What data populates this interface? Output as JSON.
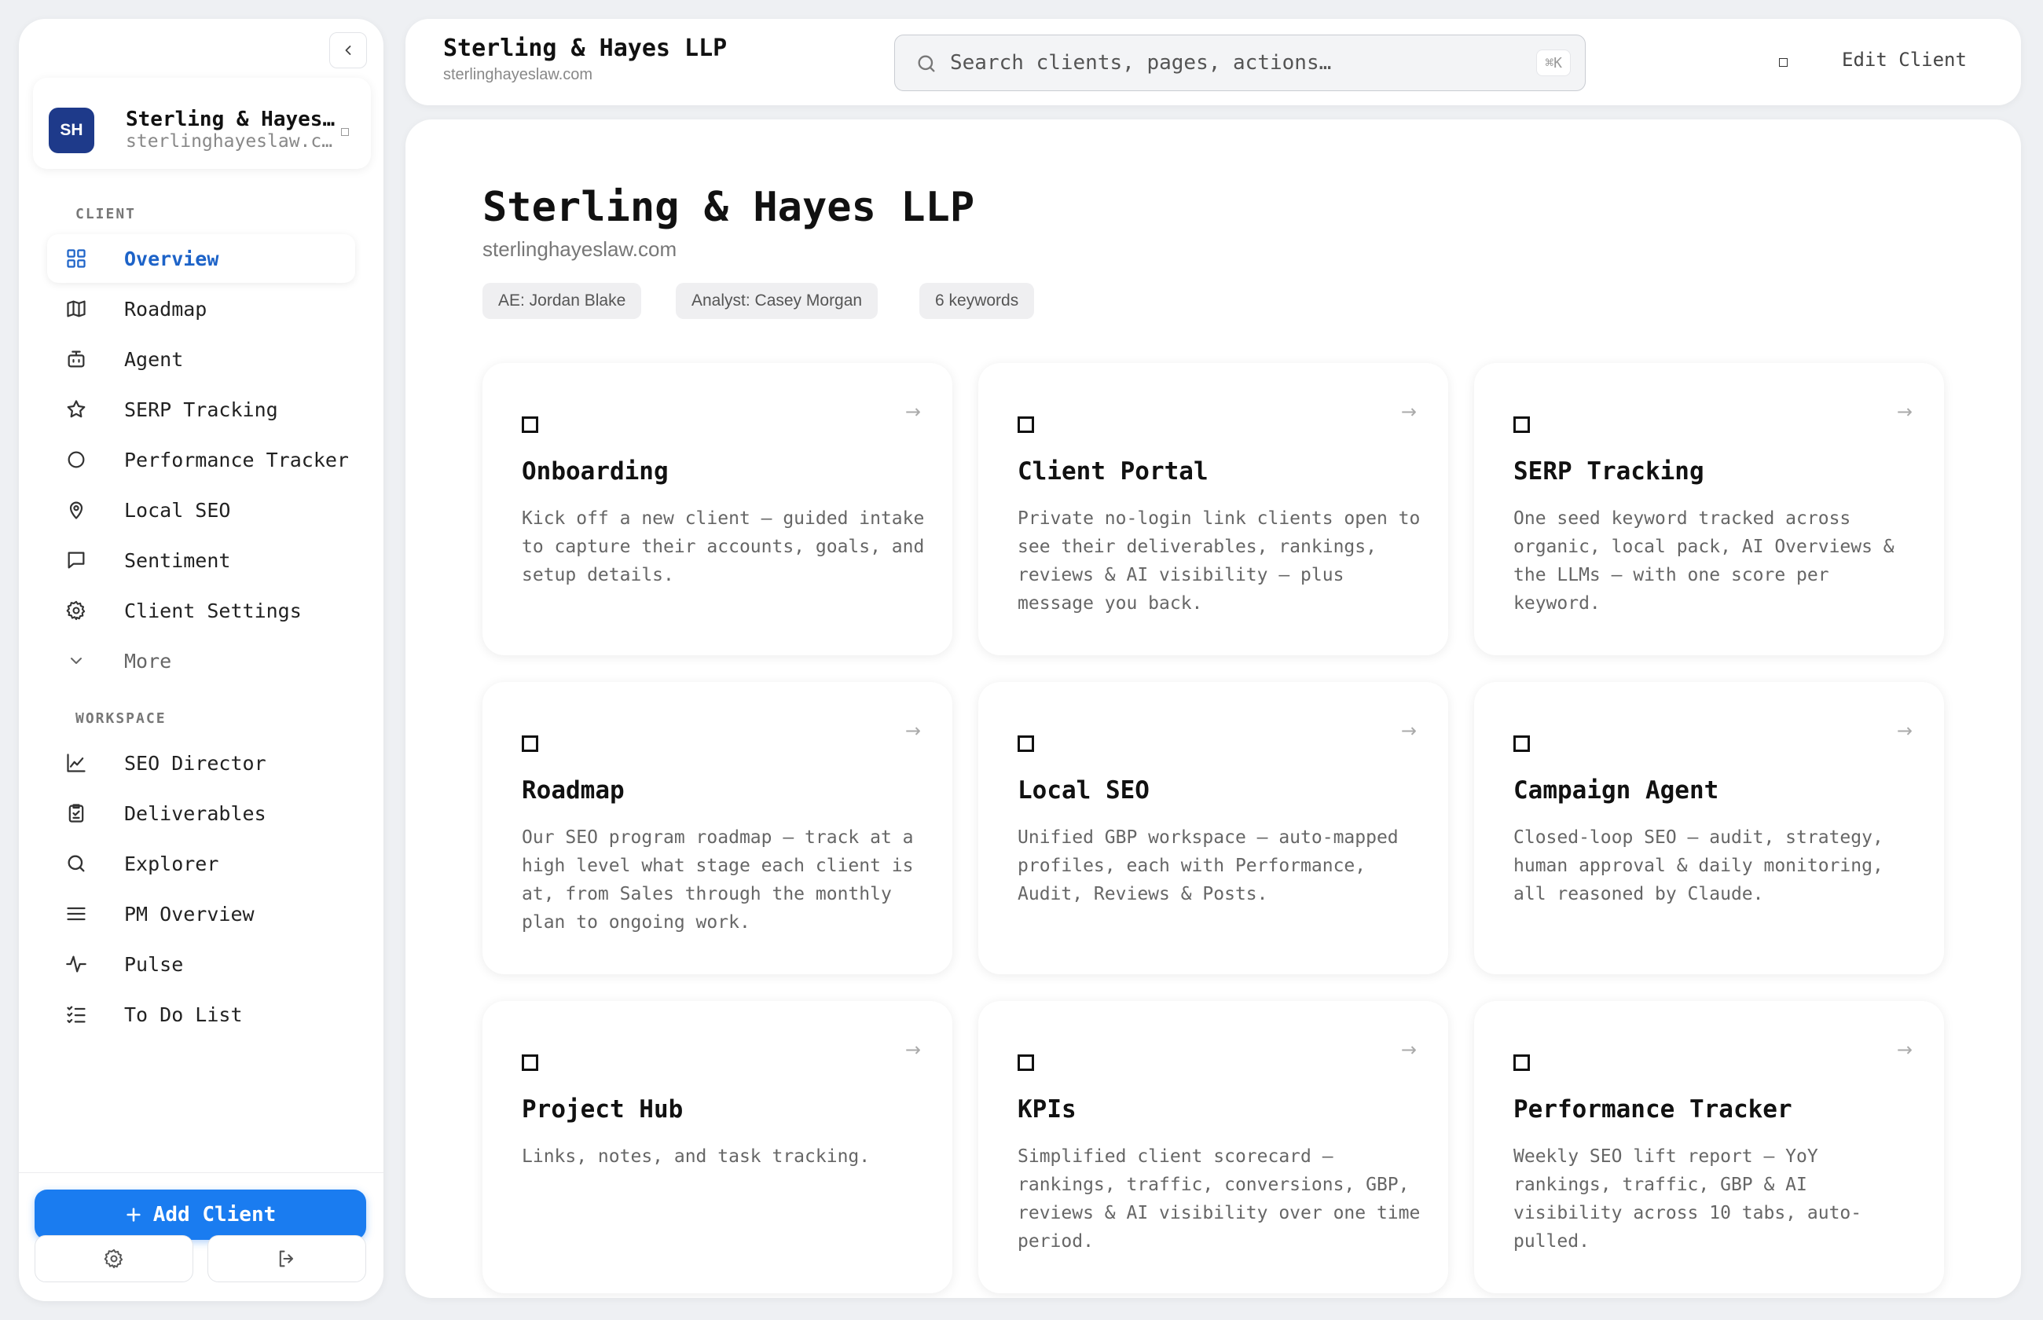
{
  "sidebar": {
    "client": {
      "initials": "SH",
      "name": "Sterling & Hayes LLP",
      "domain": "sterlinghayeslaw.com"
    },
    "sections": {
      "client_label": "CLIENT",
      "workspace_label": "WORKSPACE"
    },
    "client_items": [
      {
        "label": "Overview",
        "icon": "grid-icon"
      },
      {
        "label": "Roadmap",
        "icon": "map-icon"
      },
      {
        "label": "Agent",
        "icon": "bot-icon"
      },
      {
        "label": "SERP Tracking",
        "icon": "star-icon"
      },
      {
        "label": "Performance Tracker",
        "icon": "circle-icon"
      },
      {
        "label": "Local SEO",
        "icon": "map-pin-icon"
      },
      {
        "label": "Sentiment",
        "icon": "message-icon"
      },
      {
        "label": "Client Settings",
        "icon": "gear-icon"
      },
      {
        "label": "More",
        "icon": "chevron-down-icon"
      }
    ],
    "workspace_items": [
      {
        "label": "SEO Director",
        "icon": "line-chart-icon"
      },
      {
        "label": "Deliverables",
        "icon": "clipboard-icon"
      },
      {
        "label": "Explorer",
        "icon": "search-icon"
      },
      {
        "label": "PM Overview",
        "icon": "menu-icon"
      },
      {
        "label": "Pulse",
        "icon": "activity-icon"
      },
      {
        "label": "To Do List",
        "icon": "list-checks-icon"
      }
    ],
    "add_client_label": "Add Client"
  },
  "topbar": {
    "title": "Sterling & Hayes LLP",
    "subtitle": "sterlinghayeslaw.com",
    "search_placeholder": "Search clients, pages, actions…",
    "shortcut": "⌘K",
    "edit_label": "Edit Client"
  },
  "main": {
    "title": "Sterling & Hayes LLP",
    "subtitle": "sterlinghayeslaw.com",
    "chips": [
      "AE: Jordan Blake",
      "Analyst: Casey Morgan",
      "6 keywords"
    ],
    "cards": [
      {
        "title": "Onboarding",
        "description": "Kick off a new client — guided intake to capture their accounts, goals, and setup details."
      },
      {
        "title": "Client Portal",
        "description": "Private no-login link clients open to see their deliverables, rankings, reviews & AI visibility — plus message you back."
      },
      {
        "title": "SERP Tracking",
        "description": "One seed keyword tracked across organic, local pack, AI Overviews & the LLMs — with one score per keyword."
      },
      {
        "title": "Roadmap",
        "description": "Our SEO program roadmap — track at a high level what stage each client is at, from Sales through the monthly plan to ongoing work."
      },
      {
        "title": "Local SEO",
        "description": "Unified GBP workspace — auto-mapped profiles, each with Performance, Audit, Reviews & Posts."
      },
      {
        "title": "Campaign Agent",
        "description": "Closed-loop SEO — audit, strategy, human approval & daily monitoring, all reasoned by Claude."
      },
      {
        "title": "Project Hub",
        "description": "Links, notes, and task tracking."
      },
      {
        "title": "KPIs",
        "description": "Simplified client scorecard — rankings, traffic, conversions, GBP, reviews & AI visibility over one time period."
      },
      {
        "title": "Performance Tracker",
        "description": "Weekly SEO lift report — YoY rankings, traffic, GBP & AI visibility across 10 tabs, auto-pulled."
      }
    ]
  },
  "colors": {
    "accent": "#1a7cf0",
    "active_nav": "#1d63c8",
    "avatar": "#1e3a8a"
  }
}
